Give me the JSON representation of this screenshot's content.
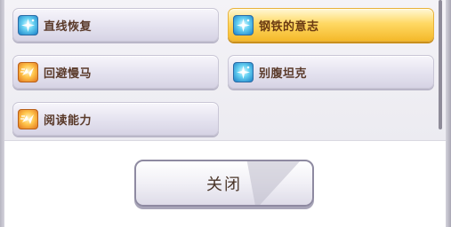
{
  "skills": [
    {
      "label": "直线恢复",
      "icon": "sparkle-icon",
      "icon_color": "blue",
      "selected": false
    },
    {
      "label": "钢铁的意志",
      "icon": "sparkle-icon",
      "icon_color": "blue",
      "selected": true
    },
    {
      "label": "回避慢马",
      "icon": "dash-icon",
      "icon_color": "orange",
      "selected": false
    },
    {
      "label": "别腹坦克",
      "icon": "sparkle-icon",
      "icon_color": "blue",
      "selected": false
    },
    {
      "label": "阅读能力",
      "icon": "dash-icon",
      "icon_color": "orange",
      "selected": false
    }
  ],
  "close_button": {
    "label": "关闭"
  },
  "colors": {
    "selected_gold": "#f4b92a",
    "card_lavender": "#e4e2ef",
    "icon_blue": "#1a80c7",
    "icon_orange": "#e0731f",
    "text_brown": "#5a3a2a"
  }
}
